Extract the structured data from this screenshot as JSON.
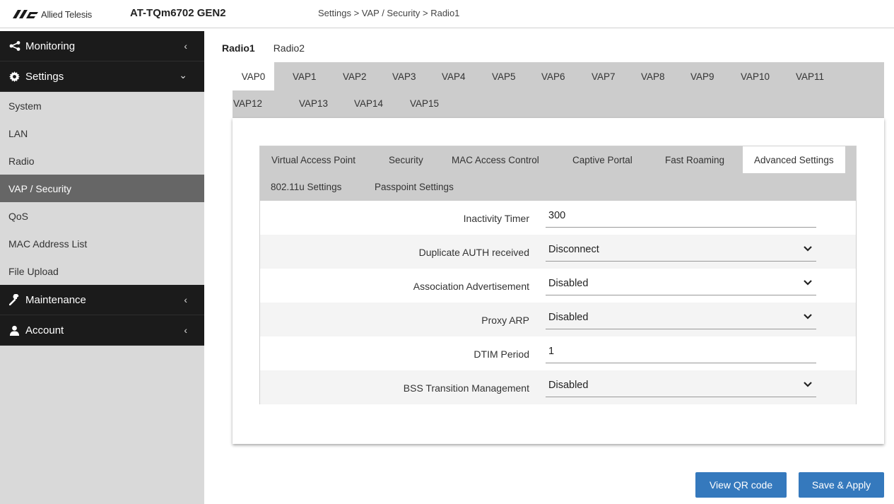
{
  "header": {
    "logo_text": "Allied Telesis",
    "product": "AT-TQm6702 GEN2",
    "breadcrumb": "Settings > VAP / Security > Radio1"
  },
  "sidebar": {
    "monitoring": "Monitoring",
    "settings": "Settings",
    "settings_items": [
      "System",
      "LAN",
      "Radio",
      "VAP / Security",
      "QoS",
      "MAC Address List",
      "File Upload"
    ],
    "active_item": "VAP / Security",
    "maintenance": "Maintenance",
    "account": "Account"
  },
  "radio_tabs": [
    "Radio1",
    "Radio2"
  ],
  "vap_tabs_row1": [
    "VAP0",
    "VAP1",
    "VAP2",
    "VAP3",
    "VAP4",
    "VAP5",
    "VAP6",
    "VAP7",
    "VAP8",
    "VAP9",
    "VAP10",
    "VAP11"
  ],
  "vap_tabs_row2": [
    "VAP12",
    "VAP13",
    "VAP14",
    "VAP15"
  ],
  "section_tabs_row1": [
    "Virtual Access Point",
    "Security",
    "MAC Access Control",
    "Captive Portal",
    "Fast Roaming",
    "Advanced Settings"
  ],
  "section_tabs_row2": [
    "802.11u Settings",
    "Passpoint Settings"
  ],
  "form": {
    "inactivity_timer": {
      "label": "Inactivity Timer",
      "value": "300"
    },
    "duplicate_auth": {
      "label": "Duplicate AUTH received",
      "value": "Disconnect"
    },
    "assoc_adv": {
      "label": "Association Advertisement",
      "value": "Disabled"
    },
    "proxy_arp": {
      "label": "Proxy ARP",
      "value": "Disabled"
    },
    "dtim_period": {
      "label": "DTIM Period",
      "value": "1"
    },
    "bss_transition": {
      "label": "BSS Transition Management",
      "value": "Disabled"
    }
  },
  "buttons": {
    "view_qr": "View QR code",
    "save_apply": "Save & Apply"
  },
  "colors": {
    "accent": "#3579bd",
    "nav_dark": "#1b1b1b",
    "panel_gray": "#cccccc",
    "sidebar_gray": "#d9d9d9",
    "active_item": "#666666"
  }
}
